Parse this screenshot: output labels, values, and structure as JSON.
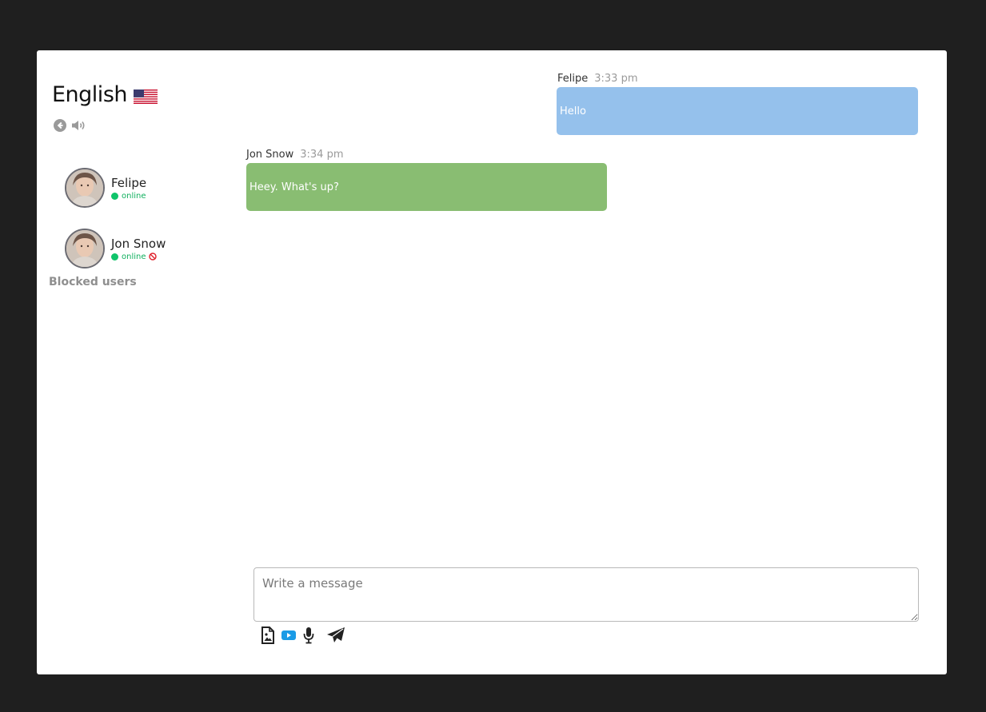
{
  "sidebar": {
    "language": "English",
    "contacts": [
      {
        "name": "Felipe",
        "status": "online",
        "blocked": false
      },
      {
        "name": "Jon Snow",
        "status": "online",
        "blocked": true
      }
    ],
    "blocked_users_label": "Blocked users"
  },
  "messages": [
    {
      "author": "Felipe",
      "time": "3:33 pm",
      "text": "Hello",
      "color": "#95c1ec"
    },
    {
      "author": "Jon Snow",
      "time": "3:34 pm",
      "text": "Heey. What's up?",
      "color": "#89bd72"
    }
  ],
  "composer": {
    "placeholder": "Write a message"
  },
  "icons": {
    "back": "arrow-circle-left-icon",
    "sound": "volume-icon",
    "flag": "us-flag-icon",
    "image": "file-image-icon",
    "video": "youtube-icon",
    "mic": "microphone-icon",
    "send": "paper-plane-icon",
    "block": "ban-icon"
  },
  "colors": {
    "online": "#0fc46a",
    "video_icon": "#1a9be6",
    "background": "#1f1f1f"
  }
}
